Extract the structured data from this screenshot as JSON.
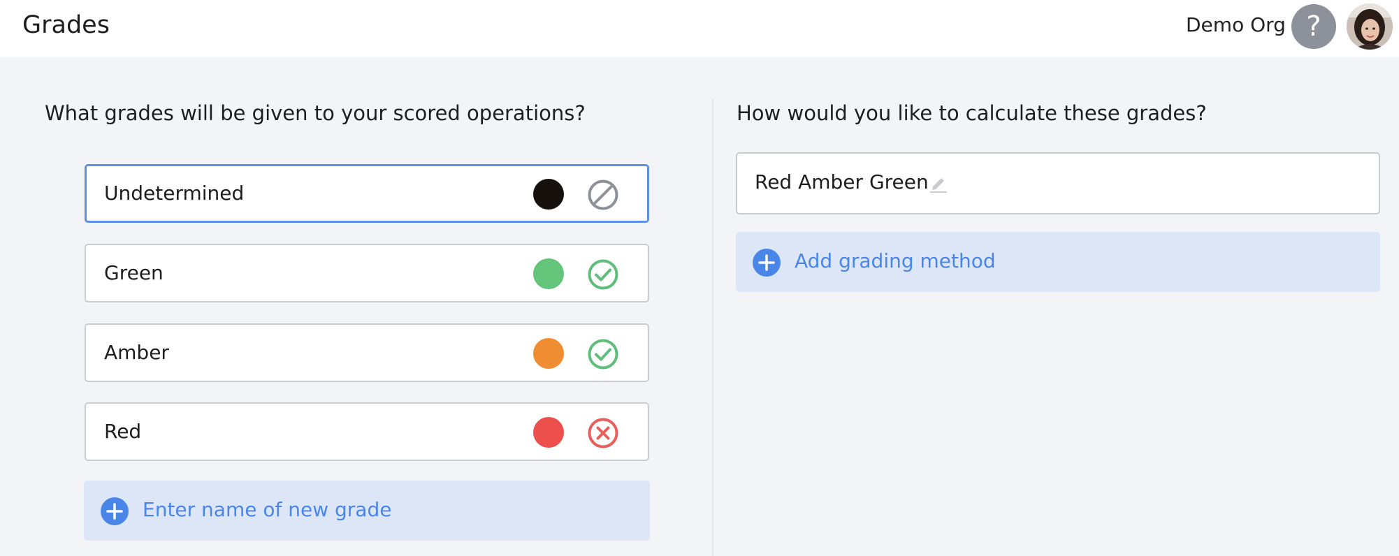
{
  "header": {
    "title": "Grades",
    "org_name": "Demo Org",
    "help_label": "?",
    "help_icon": "question-mark-icon",
    "avatar": "user-avatar"
  },
  "left_panel": {
    "question": "What grades will be given to your scored operations?",
    "grades": [
      {
        "name": "Undetermined",
        "color": "#17110e",
        "status": "disabled-icon",
        "selected": true
      },
      {
        "name": "Green",
        "color": "#63c47a",
        "status": "check-circle-icon",
        "selected": false
      },
      {
        "name": "Amber",
        "color": "#f08c32",
        "status": "check-circle-icon",
        "selected": false
      },
      {
        "name": "Red",
        "color": "#ec4f4c",
        "status": "x-circle-icon",
        "selected": false
      }
    ],
    "new_grade_placeholder": "Enter name of new grade"
  },
  "right_panel": {
    "question": "How would you like to calculate these grades?",
    "methods": [
      {
        "name": "Red Amber Green",
        "icon": "pencil-icon"
      }
    ],
    "add_method_label": "Add grading method"
  },
  "colors": {
    "accent": "#4a86e8",
    "check": "#5fbe7a",
    "cross": "#e85e5a",
    "disabled": "#8d919a",
    "add_bg": "#dce6f7"
  }
}
